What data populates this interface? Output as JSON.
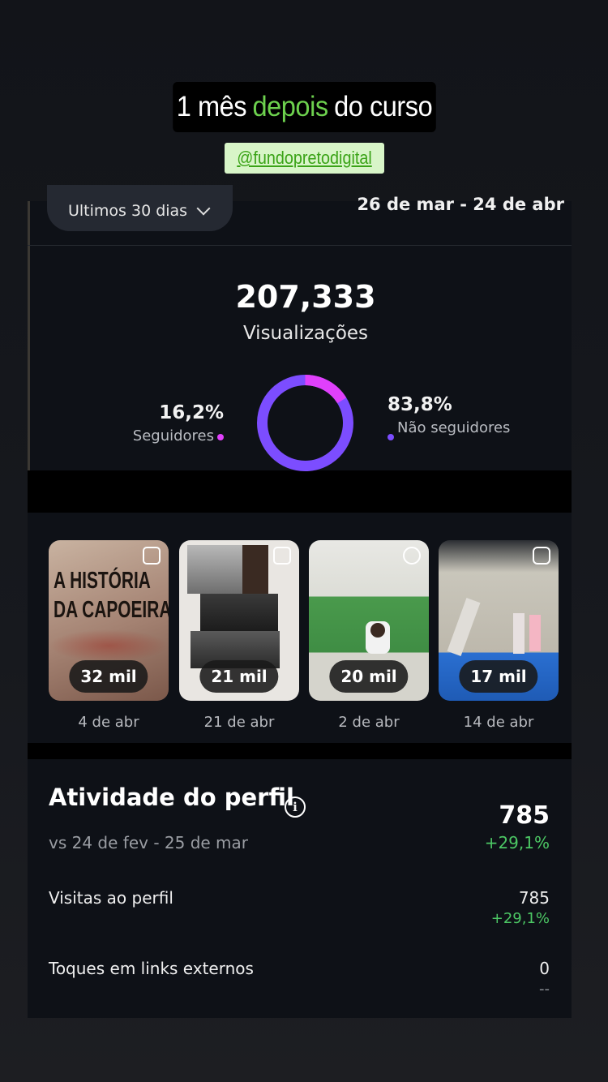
{
  "story": {
    "title_before": "1 mês",
    "title_highlight": "depois",
    "title_after": "do curso",
    "handle": "@fundopretodigital"
  },
  "header": {
    "range_label": "Ultimos 30 dias",
    "date_range": "26 de mar - 24 de abr"
  },
  "views": {
    "total": "207,333",
    "label": "Visualizações",
    "followers_pct": "16,2%",
    "followers_label": "Seguidores",
    "followers_fraction": 0.162,
    "non_followers_pct": "83,8%",
    "non_followers_label": "Não seguidores",
    "colors": {
      "followers": "#e040fb",
      "non_followers": "#7c4dff"
    }
  },
  "top_posts": [
    {
      "views": "32 mil",
      "date": "4 de abr",
      "thumb_text_1": "A HISTÓRIA",
      "thumb_text_2": "DA CAPOEIRA",
      "type_icon": "post-icon"
    },
    {
      "views": "21 mil",
      "date": "21 de abr",
      "type_icon": "post-icon"
    },
    {
      "views": "20 mil",
      "date": "2 de abr",
      "type_icon": "reel-icon"
    },
    {
      "views": "17 mil",
      "date": "14 de abr",
      "type_icon": "reel-icon"
    }
  ],
  "profile_activity": {
    "title": "Atividade do perfil",
    "compare": "vs 24 de fev - 25 de mar",
    "total": "785",
    "change": "+29,1%",
    "rows": [
      {
        "label": "Visitas ao perfil",
        "value": "785",
        "change": "+29,1%"
      },
      {
        "label": "Toques em links externos",
        "value": "0",
        "change": "--"
      }
    ]
  }
}
